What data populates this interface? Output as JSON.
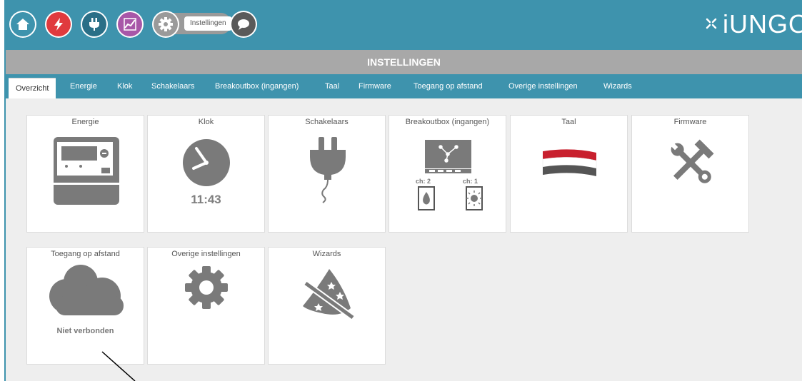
{
  "header": {
    "settings_label": "Instellingen",
    "logo_text": "iUNGO",
    "nav_icons": [
      "home-icon",
      "lightning-icon",
      "plug-icon",
      "chart-icon",
      "gear-icon",
      "chat-icon"
    ]
  },
  "page_title": "INSTELLINGEN",
  "tabs": [
    {
      "label": "Overzicht",
      "active": true
    },
    {
      "label": "Energie"
    },
    {
      "label": "Klok"
    },
    {
      "label": "Schakelaars"
    },
    {
      "label": "Breakoutbox (ingangen)"
    },
    {
      "label": "Taal"
    },
    {
      "label": "Firmware"
    },
    {
      "label": "Toegang op afstand"
    },
    {
      "label": "Overige instellingen"
    },
    {
      "label": "Wizards"
    }
  ],
  "tiles": [
    {
      "title": "Energie",
      "icon": "meter-icon"
    },
    {
      "title": "Klok",
      "icon": "clock-icon",
      "time": "11:43"
    },
    {
      "title": "Schakelaars",
      "icon": "plug-icon"
    },
    {
      "title": "Breakoutbox (ingangen)",
      "icon": "breakout-icon",
      "ch2": "ch: 2",
      "ch1": "ch: 1"
    },
    {
      "title": "Taal",
      "icon": "flag-icon"
    },
    {
      "title": "Firmware",
      "icon": "tools-icon"
    },
    {
      "title": "Toegang op afstand",
      "icon": "cloud-icon",
      "status": "Niet verbonden"
    },
    {
      "title": "Overige instellingen",
      "icon": "gear-icon"
    },
    {
      "title": "Wizards",
      "icon": "wizard-hat-icon"
    }
  ],
  "colors": {
    "header_blue": "#3e93ad",
    "title_gray": "#a8a8a8",
    "home": "#3e93ad",
    "energy": "#e03a3e",
    "plug": "#2a6f87",
    "chart": "#a857a8",
    "settings_gray": "#9a9a9a",
    "chat": "#5a5a5a",
    "flag_red": "#c8202e",
    "flag_dark": "#555555"
  }
}
